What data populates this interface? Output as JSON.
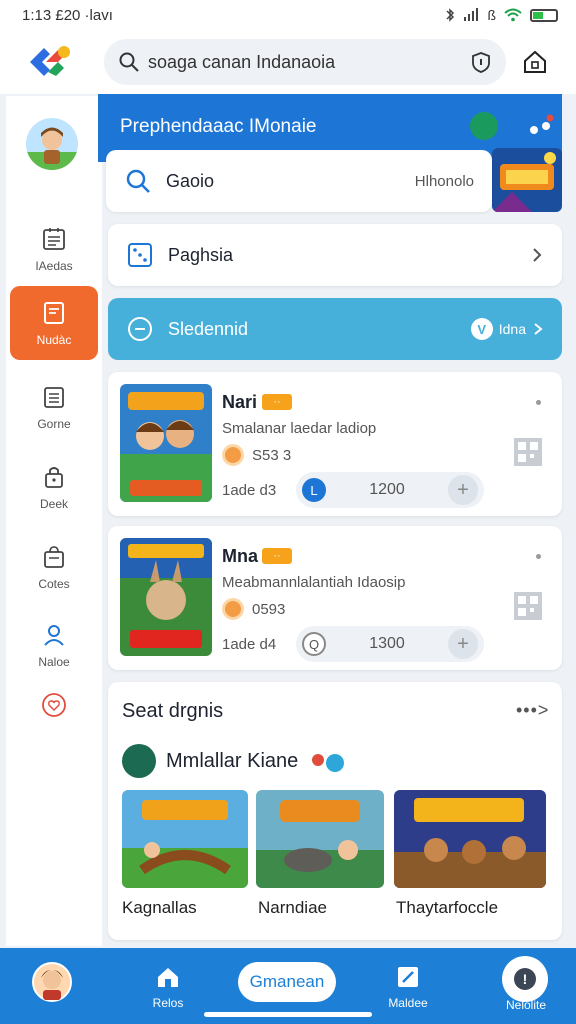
{
  "status_bar": {
    "time": "1:13 £20 ·lavı",
    "icons": [
      "bluetooth-icon",
      "signal-icon",
      "wifi-icon",
      "battery-icon"
    ],
    "misc": "ß"
  },
  "search": {
    "value": "soaga canan Indanaoia"
  },
  "sidebar": {
    "items": [
      {
        "label": "IAedas",
        "icon": "calendar-icon"
      },
      {
        "label": "Nudàc",
        "icon": "note-icon",
        "active": true
      },
      {
        "label": "Gorne",
        "icon": "document-icon"
      },
      {
        "label": "Deek",
        "icon": "lock-icon"
      },
      {
        "label": "Cotes",
        "icon": "bag-icon"
      },
      {
        "label": "Naloe",
        "icon": "person-icon"
      },
      {
        "label": "",
        "icon": "heart-icon"
      }
    ]
  },
  "hero": {
    "title": "Prephendaaac IMonaie"
  },
  "quick_rows": [
    {
      "label": "Gaoio",
      "value": "Hlhonolo",
      "icon": "search-icon"
    },
    {
      "label": "Paghsia",
      "icon": "dice-icon"
    }
  ],
  "blue_row": {
    "label": "Sledennid",
    "badge": "V",
    "value": "Idna"
  },
  "games": [
    {
      "name": "Nari",
      "tag": "··",
      "description": "Smalanar laedar ladiop",
      "coins": "S53 3",
      "category": "1ade d3",
      "price": "1200",
      "circle": "L"
    },
    {
      "name": "Mna",
      "tag": "··",
      "description": "Meabmannlalantiah Idaosip",
      "coins": "0593",
      "category": "1ade d4",
      "price": "1300",
      "circle": "Q"
    }
  ],
  "section": {
    "title": "Seat drgnis",
    "more": "•••>",
    "sub_title": "Mmlallar Kiane",
    "tiles": [
      {
        "label": "Kagnallas"
      },
      {
        "label": "Narndiae"
      },
      {
        "label": "Thaytarfoccle"
      }
    ]
  },
  "bottom_nav": {
    "items": [
      {
        "label": "Relos",
        "icon": "home-icon"
      },
      {
        "label": "Gmanean",
        "active": true
      },
      {
        "label": "Maldee",
        "icon": "edit-icon"
      },
      {
        "label": "Nelolite",
        "icon": "info-icon"
      }
    ]
  },
  "colors": {
    "accent_blue": "#1d76d6",
    "active_orange": "#ef6a2c",
    "teal_row": "#46b0da",
    "tag_orange": "#f7a21b"
  }
}
